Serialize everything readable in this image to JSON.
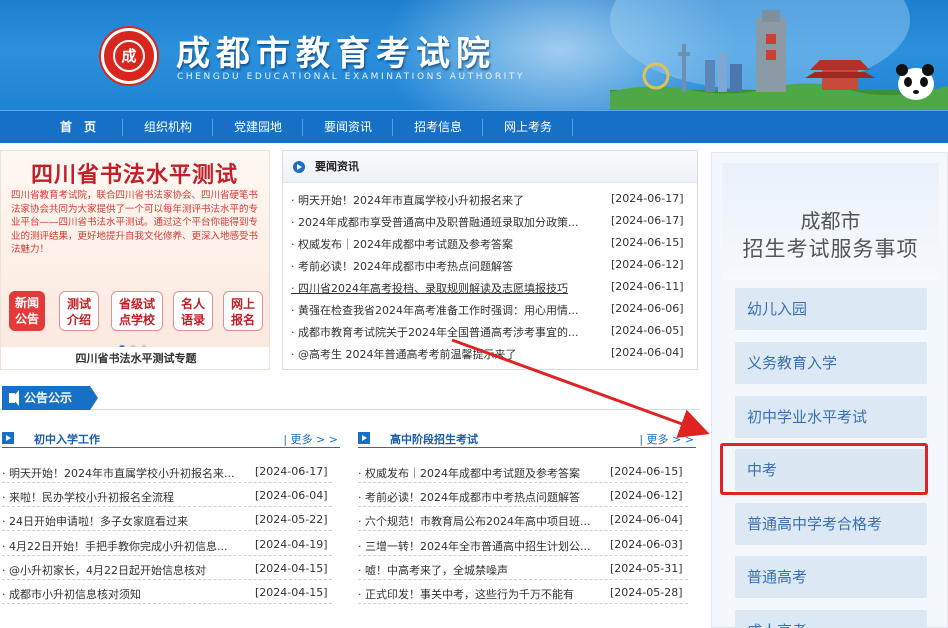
{
  "header": {
    "logo_text": "成",
    "title": "成都市教育考试院",
    "subtitle": "CHENGDU EDUCATIONAL EXAMINATIONS AUTHORITY"
  },
  "nav": {
    "items": [
      {
        "label": "首　页",
        "active": true
      },
      {
        "label": "组织机构"
      },
      {
        "label": "党建园地"
      },
      {
        "label": "要闻资讯"
      },
      {
        "label": "招考信息"
      },
      {
        "label": "网上考务"
      }
    ]
  },
  "banner": {
    "title": "四川省书法水平测试",
    "text": "四川省教育考试院，联合四川省书法家协会、四川省硬笔书法家协会共同为大家提供了一个可以每年测评书法水平的专业平台——四川省书法水平测试。通过这个平台你能得到专业的测评结果，更好地提升自我文化修养、更深入地感受书法魅力！",
    "buttons": [
      "新闻\n公告",
      "测试\n介绍",
      "省级试\n点学校",
      "名人\n语录",
      "网上\n报名"
    ],
    "caption": "四川省书法水平测试专题"
  },
  "news": {
    "title": "要闻资讯",
    "items": [
      {
        "title": "· 明天开始！2024年市直属学校小升初报名来了",
        "date": "[2024-06-17]"
      },
      {
        "title": "· 2024年成都市享受普通高中及职普融通班录取加分政策...",
        "date": "[2024-06-17]"
      },
      {
        "title": "· 权威发布｜2024年成都中考试题及参考答案",
        "date": "[2024-06-15]"
      },
      {
        "title": "· 考前必读！2024年成都市中考热点问题解答",
        "date": "[2024-06-12]"
      },
      {
        "title": "· 四川省2024年高考投档、录取规则解读及志愿填报技巧",
        "date": "[2024-06-11]"
      },
      {
        "title": "· 黄强在检查我省2024年高考准备工作时强调：用心用情...",
        "date": "[2024-06-06]"
      },
      {
        "title": "· 成都市教育考试院关于2024年全国普通高考涉考事宜的...",
        "date": "[2024-06-05]"
      },
      {
        "title": "· @高考生 2024年普通高考考前温馨提示来了",
        "date": "[2024-06-04]"
      }
    ]
  },
  "notice": {
    "label": "公告公示"
  },
  "primary": {
    "title": "初中入学工作",
    "more": "| 更多 > >",
    "items": [
      {
        "title": "· 明天开始！2024年市直属学校小升初报名来...",
        "date": "[2024-06-17]"
      },
      {
        "title": "· 来啦！民办学校小升初报名全流程",
        "date": "[2024-06-04]"
      },
      {
        "title": "· 24日开始申请啦！多子女家庭看过来",
        "date": "[2024-05-22]"
      },
      {
        "title": "· 4月22日开始！手把手教你完成小升初信息...",
        "date": "[2024-04-19]"
      },
      {
        "title": "· @小升初家长，4月22日起开始信息核对",
        "date": "[2024-04-15]"
      },
      {
        "title": "· 成都市小升初信息核对须知",
        "date": "[2024-04-15]"
      }
    ]
  },
  "highschool": {
    "title": "高中阶段招生考试",
    "more": "| 更多 > >",
    "items": [
      {
        "title": "· 权威发布｜2024年成都中考试题及参考答案",
        "date": "[2024-06-15]"
      },
      {
        "title": "· 考前必读！2024年成都市中考热点问题解答",
        "date": "[2024-06-12]"
      },
      {
        "title": "· 六个规范！市教育局公布2024年高中项目班...",
        "date": "[2024-06-04]"
      },
      {
        "title": "· 三增一转！2024年全市普通高中招生计划公...",
        "date": "[2024-06-03]"
      },
      {
        "title": "· 嘘！中高考来了，全城禁噪声",
        "date": "[2024-05-31]"
      },
      {
        "title": "· 正式印发！事关中考，这些行为千万不能有",
        "date": "[2024-05-28]"
      }
    ]
  },
  "services": {
    "title_line1": "成都市",
    "title_line2": "招生考试服务事项",
    "items": [
      "幼儿入园",
      "义务教育入学",
      "初中学业水平考试",
      "中考",
      "普通高中学考合格考",
      "普通高考",
      "成人高考"
    ]
  },
  "colors": {
    "primary": "#1570c6",
    "highlight": "#e12222",
    "banner_red": "#c21f27"
  }
}
